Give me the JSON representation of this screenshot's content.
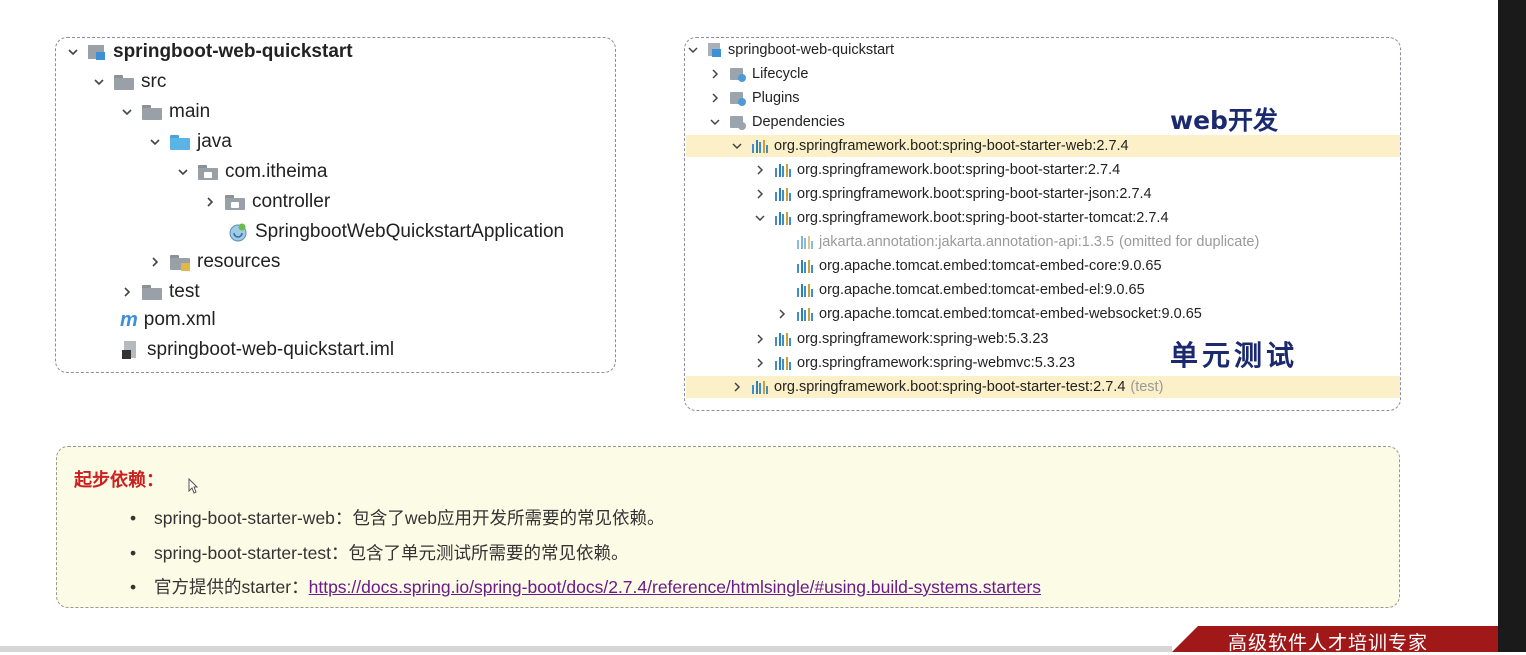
{
  "left_tree": {
    "root": "springboot-web-quickstart",
    "src": "src",
    "main": "main",
    "java": "java",
    "package": "com.itheima",
    "controller": "controller",
    "app_class": "SpringbootWebQuickstartApplication",
    "resources": "resources",
    "test": "test",
    "pom": "pom.xml",
    "iml": "springboot-web-quickstart.iml"
  },
  "right_tree": {
    "root": "springboot-web-quickstart",
    "lifecycle": "Lifecycle",
    "plugins": "Plugins",
    "dependencies": "Dependencies",
    "deps": [
      "org.springframework.boot:spring-boot-starter-web:2.7.4",
      "org.springframework.boot:spring-boot-starter:2.7.4",
      "org.springframework.boot:spring-boot-starter-json:2.7.4",
      "org.springframework.boot:spring-boot-starter-tomcat:2.7.4",
      "jakarta.annotation:jakarta.annotation-api:1.3.5",
      "org.apache.tomcat.embed:tomcat-embed-core:9.0.65",
      "org.apache.tomcat.embed:tomcat-embed-el:9.0.65",
      "org.apache.tomcat.embed:tomcat-embed-websocket:9.0.65",
      "org.springframework:spring-web:5.3.23",
      "org.springframework:spring-webmvc:5.3.23",
      "org.springframework.boot:spring-boot-starter-test:2.7.4"
    ],
    "omitted_suffix": "(omitted for duplicate)",
    "test_scope": "(test)"
  },
  "annotations": {
    "web_dev": "web开发",
    "unit_test": "单元测试"
  },
  "notes": {
    "title": "起步依赖：",
    "bullets": [
      "spring-boot-starter-web：包含了web应用开发所需要的常见依赖。",
      "spring-boot-starter-test：包含了单元测试所需要的常见依赖。"
    ],
    "starter_prefix": "官方提供的starter：",
    "starter_link": "https://docs.spring.io/spring-boot/docs/2.7.4/reference/htmlsingle/#using.build-systems.starters",
    "bullet_mark": "•"
  },
  "watermark": "高级软件人才培训专家",
  "colors": {
    "highlight": "#fbf0c8",
    "title_red": "#cc1f1f",
    "note_bg": "#fcfbe6",
    "watermark_red": "#a11818"
  }
}
